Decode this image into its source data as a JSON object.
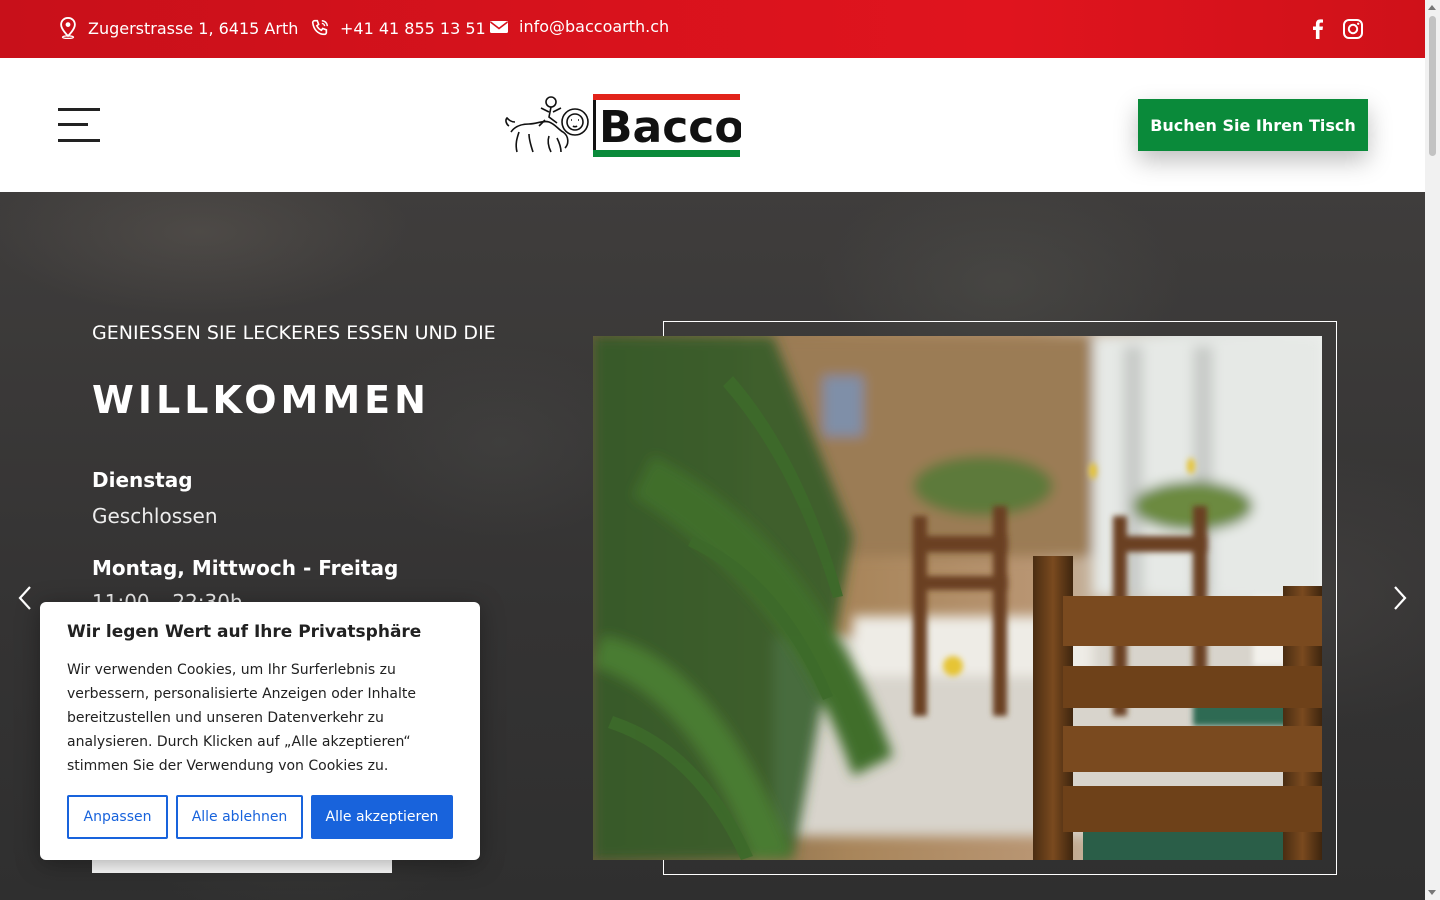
{
  "topbar": {
    "address": "Zugerstrasse 1, 6415 Arth",
    "phone": "+41 41 855 13 51",
    "email": "info@baccoarth.ch",
    "icons": [
      "location-pin-icon",
      "phone-icon",
      "mail-icon",
      "facebook-icon",
      "instagram-icon"
    ],
    "background": "#d7121c"
  },
  "header": {
    "logo_text": "Bacco",
    "book_button": "Buchen Sie Ihren Tisch",
    "accent_green": "#0a8a3a"
  },
  "hero": {
    "tagline": "GENIESSEN SIE LECKERES ESSEN UND DIE",
    "title": "WILLKOMMEN",
    "hours": [
      {
        "day": "Dienstag",
        "time": "Geschlossen"
      },
      {
        "day": "Montag, Mittwoch - Freitag",
        "time": "11:00 – 22:30h"
      }
    ]
  },
  "cookie": {
    "title": "Wir legen Wert auf Ihre Privatsphäre",
    "text": "Wir verwenden Cookies, um Ihr Surferlebnis zu verbessern, personalisierte Anzeigen oder Inhalte bereitzustellen und unseren Datenverkehr zu analysieren. Durch Klicken auf „Alle akzeptieren“ stimmen Sie der Verwendung von Cookies zu.",
    "customize": "Anpassen",
    "reject": "Alle ablehnen",
    "accept": "Alle akzeptieren",
    "accent_blue": "#1863dc"
  }
}
